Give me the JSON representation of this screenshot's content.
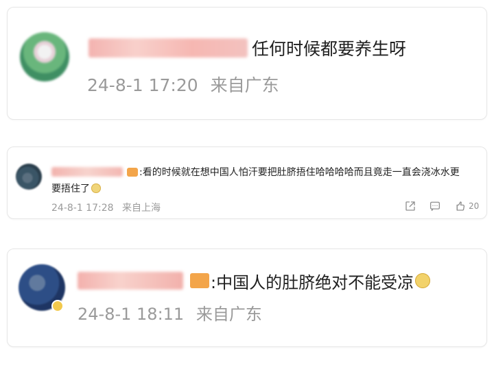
{
  "comments": [
    {
      "text": "任何时候都要养生呀",
      "time": "24-8-1 17:20",
      "location": "来自广东"
    },
    {
      "text": ":看的时候就在想中国人怕汗要把肚脐捂住哈哈哈哈而且竟走一直会浇冰水更",
      "text_line2": "要捂住了",
      "time": "24-8-1 17:28",
      "location": "来自上海",
      "like_count": "20"
    },
    {
      "text": ":中国人的肚脐绝对不能受凉",
      "time": "24-8-1 18:11",
      "location": "来自广东"
    }
  ],
  "icons": {
    "share": "share-icon",
    "comment": "comment-icon",
    "like": "thumbs-up-icon"
  },
  "colors": {
    "text": "#1f1f1f",
    "meta": "#9a9a9a",
    "card_border": "#e6e6e6",
    "badge": "#f3a54a"
  }
}
